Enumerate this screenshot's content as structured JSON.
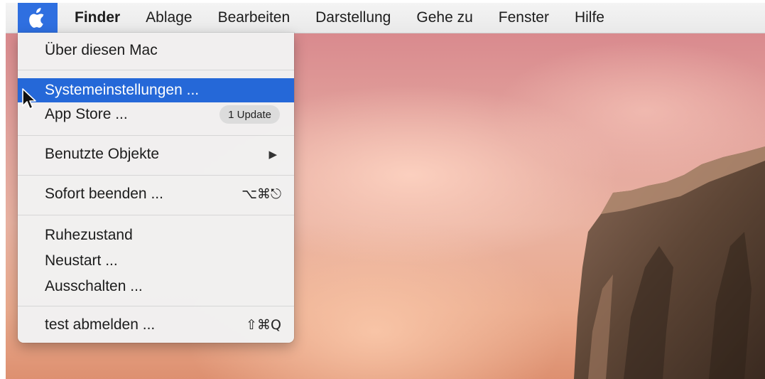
{
  "menubar": {
    "apple_icon": "apple-logo-icon",
    "items": [
      "Finder",
      "Ablage",
      "Bearbeiten",
      "Darstellung",
      "Gehe zu",
      "Fenster",
      "Hilfe"
    ]
  },
  "apple_menu": {
    "about": "Über diesen Mac",
    "system_preferences": "Systemeinstellungen ...",
    "app_store": "App Store ...",
    "app_store_badge": "1 Update",
    "recent_items": "Benutzte Objekte",
    "force_quit": "Sofort beenden ...",
    "force_quit_shortcut": "⌥⌘⎋",
    "sleep": "Ruhezustand",
    "restart": "Neustart ...",
    "shutdown": "Ausschalten ...",
    "logout": "test abmelden ...",
    "logout_shortcut": "⇧⌘Q"
  },
  "colors": {
    "selection": "#2568d8",
    "apple_highlight": "#2f6fe0"
  }
}
